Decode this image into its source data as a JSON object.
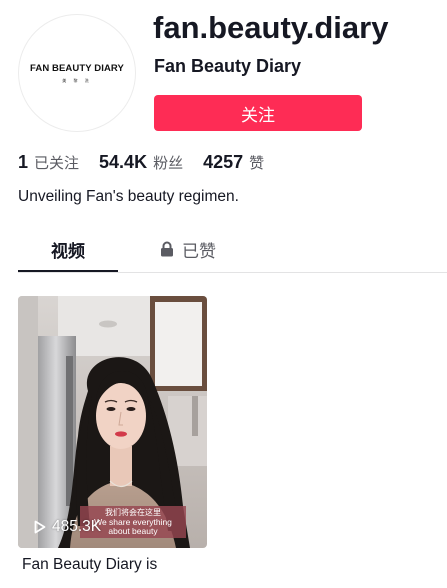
{
  "profile": {
    "avatar_brand": "FAN BEAUTY DIARY",
    "avatar_sub": "美 黎 洗",
    "username": "fan.beauty.diary",
    "display_name": "Fan Beauty Diary",
    "follow_label": "关注",
    "bio": "Unveiling Fan's beauty regimen."
  },
  "stats": [
    {
      "value": "1",
      "label": "已关注"
    },
    {
      "value": "54.4K",
      "label": "粉丝"
    },
    {
      "value": "4257",
      "label": "赞"
    }
  ],
  "tabs": [
    {
      "label": "视频",
      "active": true
    },
    {
      "label": "已赞",
      "icon": "lock-icon",
      "active": false
    }
  ],
  "videos": [
    {
      "views": "485.3K",
      "caption_cn": "我们将会在这里",
      "caption_en_1": "We share everything",
      "caption_en_2": "about beauty",
      "description": "Fan Beauty Diary is",
      "icon": "play-icon"
    }
  ],
  "colors": {
    "accent": "#fe2c55",
    "text_primary": "#161823",
    "text_secondary": "#5a5b62"
  }
}
